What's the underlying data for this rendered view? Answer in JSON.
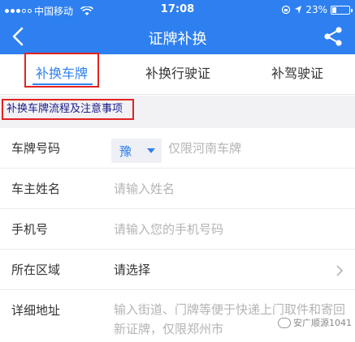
{
  "status_bar": {
    "carrier": "中国移动",
    "time": "17:08",
    "battery_text": "23%",
    "battery_level": 0.23
  },
  "nav": {
    "title": "证牌补换",
    "back_icon": "back-chevron-icon",
    "share_icon": "share-icon"
  },
  "tabs": [
    {
      "label": "补换车牌",
      "active": true
    },
    {
      "label": "补换行驶证",
      "active": false
    },
    {
      "label": "补驾驶证",
      "active": false
    }
  ],
  "notice": {
    "label": "补换车牌流程及注意事项"
  },
  "form": {
    "plate": {
      "label": "车牌号码",
      "province": "豫",
      "placeholder": "仅限河南车牌"
    },
    "owner": {
      "label": "车主姓名",
      "placeholder": "请输入姓名"
    },
    "phone": {
      "label": "手机号",
      "placeholder": "请输入您的手机号码"
    },
    "region": {
      "label": "所在区域",
      "value": "请选择"
    },
    "address": {
      "label": "详细地址",
      "placeholder": "输入街道、门牌等便于快递上门取件和寄回新证牌，仅限郑州市"
    }
  },
  "watermark": {
    "text": "安广顺源1041"
  },
  "colors": {
    "brand": "#2e80f0",
    "highlight_box": "#e32222"
  }
}
